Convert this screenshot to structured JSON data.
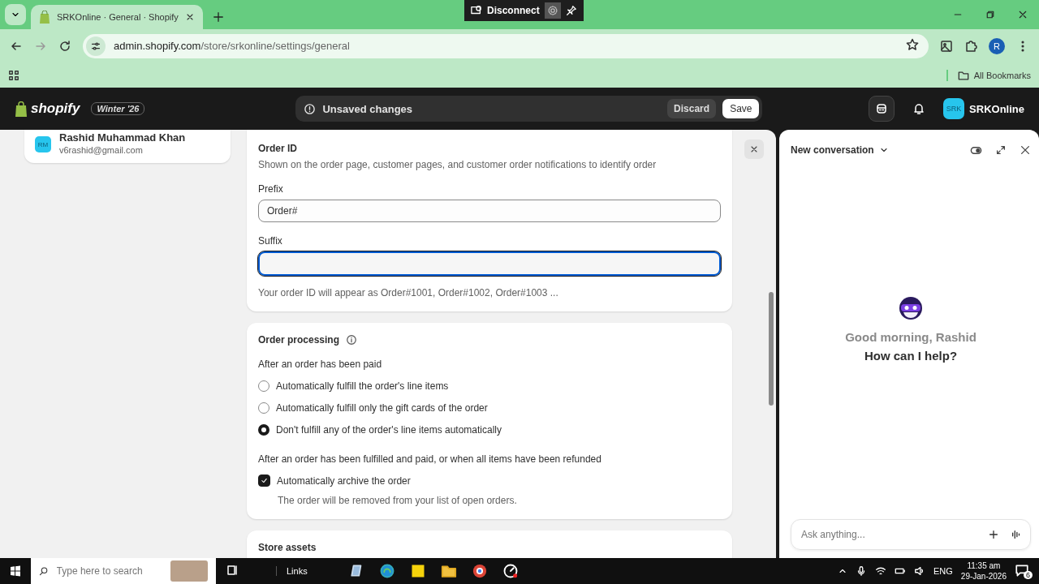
{
  "browser": {
    "tab_title": "SRKOnline · General · Shopify",
    "url_host": "admin.shopify.com",
    "url_path": "/store/srkonline/settings/general",
    "remote_label": "Disconnect",
    "profile_initial": "R",
    "bookmarks_label": "All Bookmarks"
  },
  "topbar": {
    "logo": "shopify",
    "edition": "Winter '26",
    "unsaved": "Unsaved changes",
    "discard": "Discard",
    "save": "Save",
    "store_initials": "SRK",
    "store_name": "SRKOnline"
  },
  "sidebar": {
    "user": {
      "initials": "RM",
      "name": "Rashid Muhammad Khan",
      "email": "v6rashid@gmail.com"
    }
  },
  "order_id": {
    "title": "Order ID",
    "description": "Shown on the order page, customer pages, and customer order notifications to identify order",
    "prefix_label": "Prefix",
    "prefix_value": "Order#",
    "suffix_label": "Suffix",
    "suffix_focused": true,
    "help": "Your order ID will appear as Order#1001, Order#1002, Order#1003 ..."
  },
  "order_processing": {
    "title": "Order processing",
    "paid_label": "After an order has been paid",
    "options": [
      {
        "label": "Automatically fulfill the order's line items",
        "selected": false
      },
      {
        "label": "Automatically fulfill only the gift cards of the order",
        "selected": false
      },
      {
        "label": "Don't fulfill any of the order's line items automatically",
        "selected": true
      }
    ],
    "fulfilled_label": "After an order has been fulfilled and paid, or when all items have been refunded",
    "archive": {
      "label": "Automatically archive the order",
      "checked": true,
      "description": "The order will be removed from your list of open orders."
    }
  },
  "next_section": {
    "title": "Store assets"
  },
  "chat": {
    "title": "New conversation",
    "greeting": "Good morning, Rashid",
    "question": "How can I help?",
    "placeholder": "Ask anything..."
  },
  "taskbar": {
    "search_placeholder": "Type here to search",
    "links": "Links",
    "language": "ENG",
    "time": "11:35 am",
    "date": "29-Jan-2026",
    "notifications": "6"
  }
}
